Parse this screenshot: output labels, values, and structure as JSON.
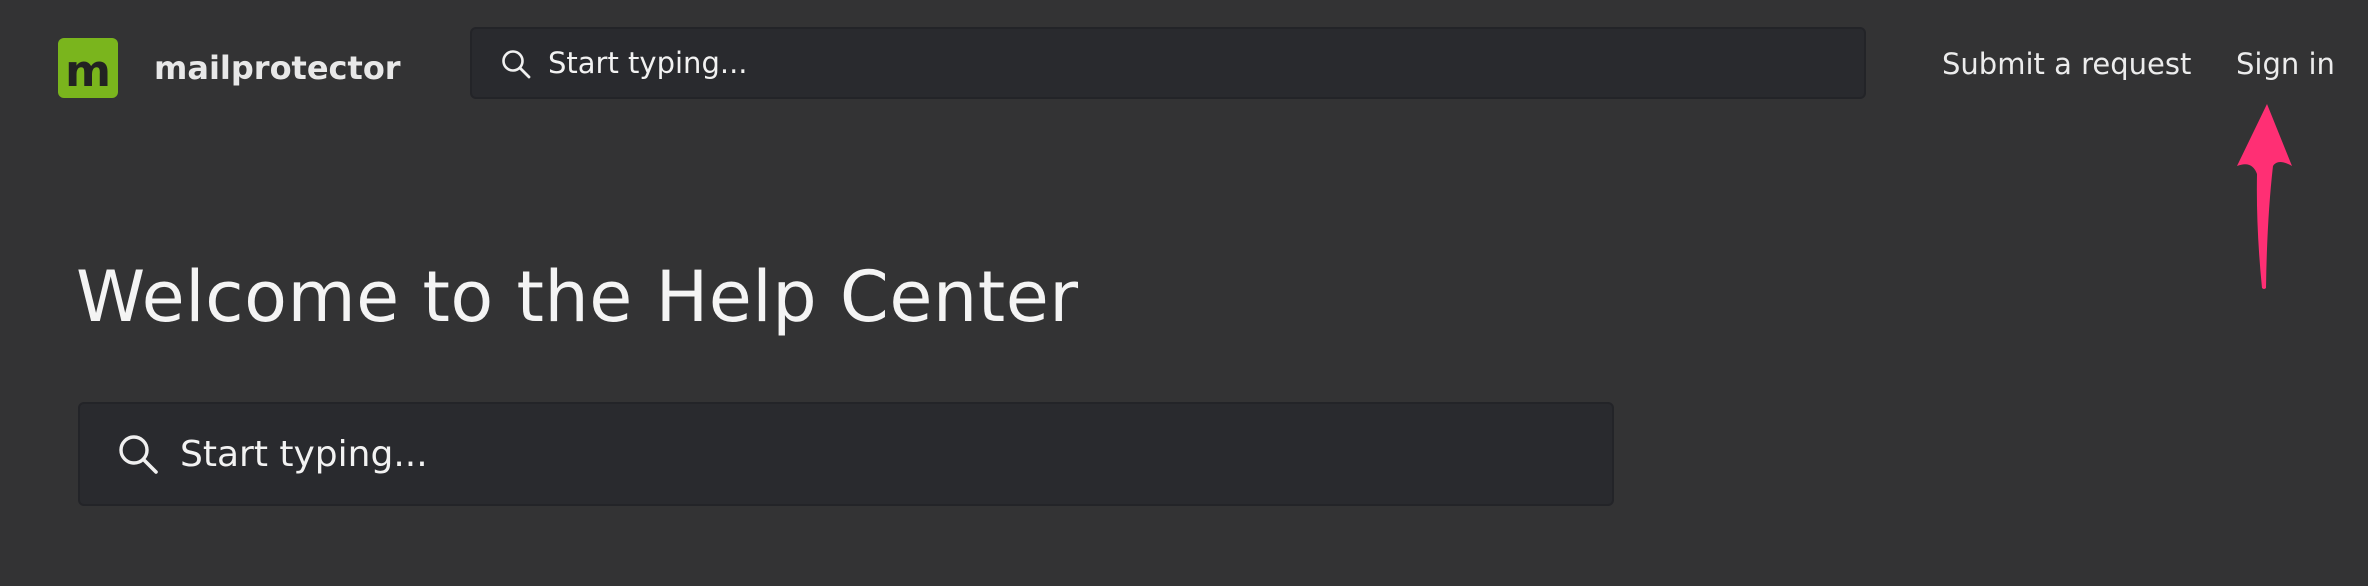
{
  "brand": {
    "logo_letter": "m",
    "name": "mailprotector",
    "accent_color": "#7ab51d"
  },
  "header": {
    "search": {
      "placeholder": "Start typing...",
      "icon": "search-icon"
    },
    "nav": {
      "submit_request": "Submit a request",
      "sign_in": "Sign in"
    }
  },
  "hero": {
    "title": "Welcome to the Help Center",
    "search": {
      "placeholder": "Start typing...",
      "icon": "search-icon"
    }
  },
  "annotation": {
    "type": "arrow",
    "points_to": "sign-in-link",
    "color": "#ff2f74"
  }
}
